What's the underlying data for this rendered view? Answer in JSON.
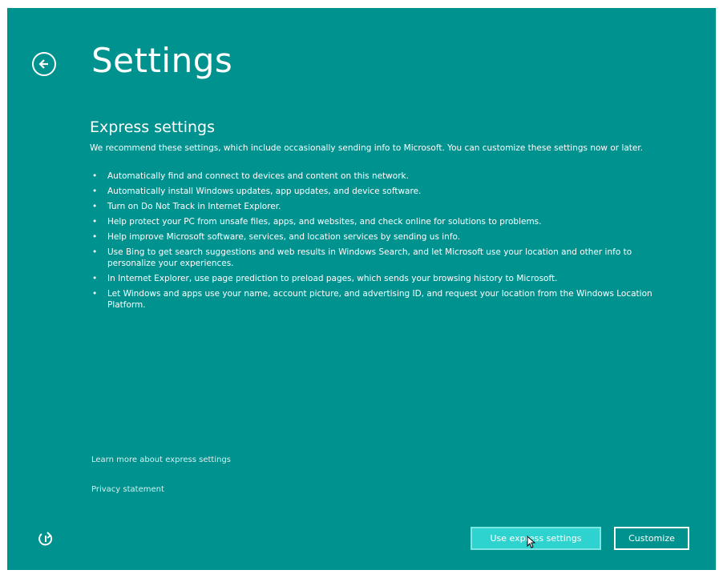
{
  "header": {
    "title": "Settings",
    "back_icon": "arrow-left-circle-icon"
  },
  "express": {
    "heading": "Express settings",
    "intro": "We recommend these settings, which include occasionally sending info to Microsoft. You can customize these settings now or later.",
    "bullet_char": "•",
    "items": [
      "Automatically find and connect to devices and content on this network.",
      "Automatically install Windows updates, app updates, and device software.",
      "Turn on Do Not Track in Internet Explorer.",
      "Help protect your PC from unsafe files, apps, and websites, and check online for solutions to problems.",
      "Help improve Microsoft software, services, and location services by sending us info.",
      "Use Bing to get search suggestions and web results in Windows Search, and let Microsoft use your location and other info to personalize your experiences.",
      "In Internet Explorer, use page prediction to preload pages, which sends your browsing history to Microsoft.",
      "Let Windows and apps use your name, account picture, and advertising ID, and request your location from the Windows Location Platform."
    ]
  },
  "links": {
    "learn_more": "Learn more about express settings",
    "privacy": "Privacy statement"
  },
  "footer": {
    "ease_of_access_icon": "ease-of-access-icon",
    "primary_button": "Use express settings",
    "secondary_button": "Customize"
  },
  "colors": {
    "background": "#00928f",
    "primary_button": "#2ed3cf",
    "text": "#ffffff"
  }
}
